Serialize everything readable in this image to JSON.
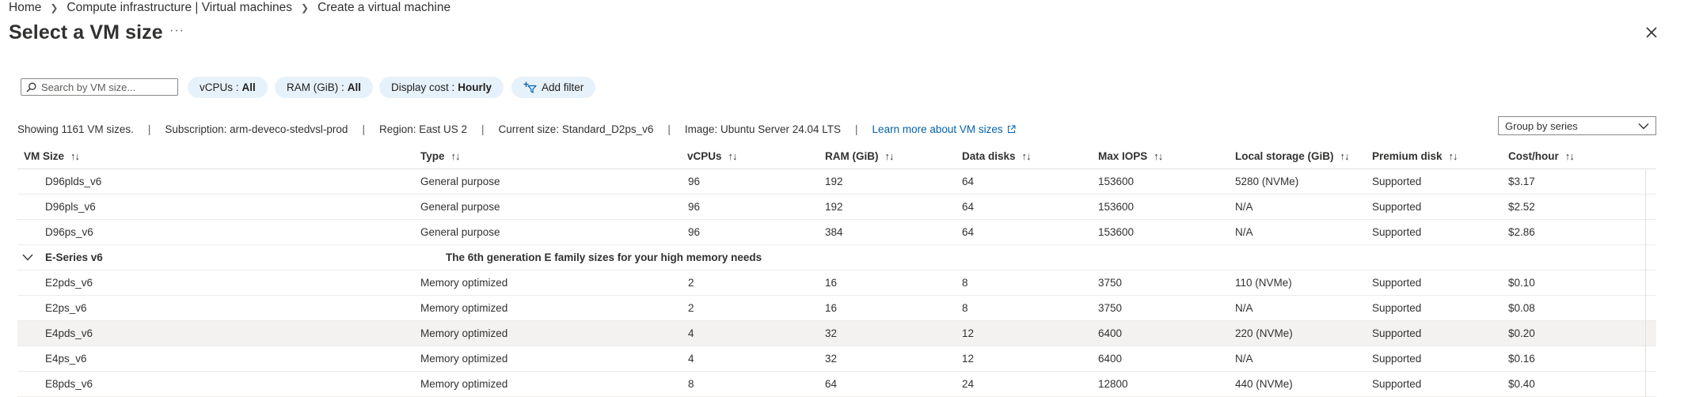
{
  "breadcrumb": {
    "items": [
      "Home",
      "Compute infrastructure | Virtual machines",
      "Create a virtual machine"
    ]
  },
  "page": {
    "title": "Select a VM size",
    "more_label": "···"
  },
  "filters": {
    "search_placeholder": "Search by VM size...",
    "vcpus": {
      "label": "vCPUs :",
      "value": "All"
    },
    "ram": {
      "label": "RAM (GiB) :",
      "value": "All"
    },
    "display_cost": {
      "label": "Display cost :",
      "value": "Hourly"
    },
    "add_filter_label": "Add filter"
  },
  "info": {
    "showing": "Showing 1161 VM sizes.",
    "subscription": "Subscription: arm-deveco-stedvsl-prod",
    "region": "Region: East US 2",
    "current_size": "Current size: Standard_D2ps_v6",
    "image": "Image: Ubuntu Server 24.04 LTS",
    "learn_more": "Learn more about VM sizes",
    "divider": "|"
  },
  "group_by": {
    "value": "Group by series"
  },
  "table": {
    "sort_glyph": "↑↓",
    "columns": [
      "VM Size",
      "Type",
      "vCPUs",
      "RAM (GiB)",
      "Data disks",
      "Max IOPS",
      "Local storage (GiB)",
      "Premium disk",
      "Cost/hour"
    ],
    "rows_before": [
      [
        "D96plds_v6",
        "General purpose",
        "96",
        "192",
        "64",
        "153600",
        "5280 (NVMe)",
        "Supported",
        "$3.17"
      ],
      [
        "D96pls_v6",
        "General purpose",
        "96",
        "192",
        "64",
        "153600",
        "N/A",
        "Supported",
        "$2.52"
      ],
      [
        "D96ps_v6",
        "General purpose",
        "96",
        "384",
        "64",
        "153600",
        "N/A",
        "Supported",
        "$2.86"
      ]
    ],
    "group": {
      "name": "E-Series v6",
      "description": "The 6th generation E family sizes for your high memory needs"
    },
    "rows_after": [
      [
        "E2pds_v6",
        "Memory optimized",
        "2",
        "16",
        "8",
        "3750",
        "110 (NVMe)",
        "Supported",
        "$0.10"
      ],
      [
        "E2ps_v6",
        "Memory optimized",
        "2",
        "16",
        "8",
        "3750",
        "N/A",
        "Supported",
        "$0.08"
      ],
      [
        "E4pds_v6",
        "Memory optimized",
        "4",
        "32",
        "12",
        "6400",
        "220 (NVMe)",
        "Supported",
        "$0.20"
      ],
      [
        "E4ps_v6",
        "Memory optimized",
        "4",
        "32",
        "12",
        "6400",
        "N/A",
        "Supported",
        "$0.16"
      ],
      [
        "E8pds_v6",
        "Memory optimized",
        "8",
        "64",
        "24",
        "12800",
        "440 (NVMe)",
        "Supported",
        "$0.40"
      ]
    ],
    "selected_row": "E4pds_v6"
  }
}
